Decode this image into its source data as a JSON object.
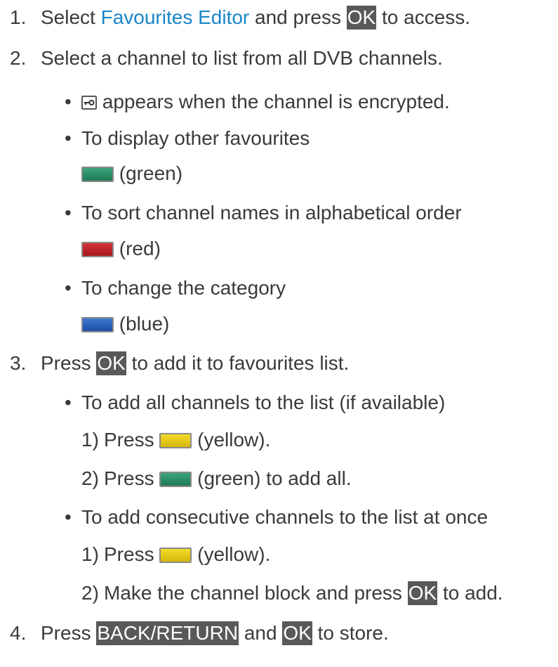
{
  "steps": [
    {
      "num": "1.",
      "before": "Select ",
      "link": "Favourites Editor",
      "middle": " and press ",
      "key": "OK",
      "after": " to access."
    },
    {
      "num": "2.",
      "text": "Select a channel to list from all DVB channels."
    },
    {
      "num": "3.",
      "before": "Press ",
      "key": "OK",
      "after": " to add it to favourites list."
    },
    {
      "num": "4.",
      "before": "Press ",
      "key": "BACK/RETURN",
      "middle": " and ",
      "key2": "OK",
      "after": " to store."
    }
  ],
  "step2_bullets": {
    "encrypted": " appears when the channel is encrypted.",
    "favourites": "To display other favourites",
    "favourites_note": " (green)",
    "sort": "To sort channel names in alphabetical order",
    "sort_note": " (red)",
    "category": "To change the category",
    "category_note": " (blue)"
  },
  "step3_bullets": {
    "add_all": "To add all channels to the list (if available)",
    "add_all_sub": [
      {
        "num": "1)",
        "before": "Press ",
        "after": " (yellow)."
      },
      {
        "num": "2)",
        "before": "Press ",
        "after": " (green) to add all."
      }
    ],
    "add_consecutive": "To add consecutive channels to the list at once",
    "add_consecutive_sub": [
      {
        "num": "1)",
        "before": "Press ",
        "after": " (yellow)."
      },
      {
        "num": "2)",
        "before": "Make the channel block and press ",
        "key": "OK",
        "after": " to add."
      }
    ]
  },
  "bullet_char": "•",
  "icons": {
    "encrypted": "lock-icon",
    "green": "green-button-icon",
    "red": "red-button-icon",
    "blue": "blue-button-icon",
    "yellow": "yellow-button-icon"
  },
  "colors": {
    "text": "#3a3a3a",
    "link": "#1a86c8",
    "key_bg": "#595959",
    "green": "#2b9068",
    "red": "#be2229",
    "blue": "#2c63bd",
    "yellow": "#e6c81a"
  }
}
